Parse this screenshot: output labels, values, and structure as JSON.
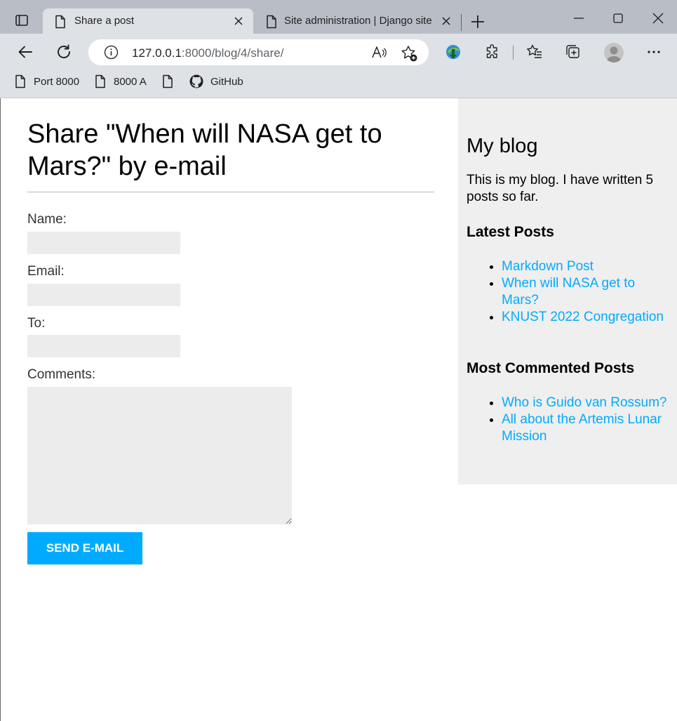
{
  "browser": {
    "tabs": [
      {
        "title": "Share a post",
        "active": true
      },
      {
        "title": "Site administration | Django site admin",
        "active": false
      }
    ],
    "url_host": "127.0.0.1",
    "url_rest": ":8000/blog/4/share/",
    "bookmarks": [
      {
        "label": "Port 8000",
        "icon": "page-icon"
      },
      {
        "label": "8000 A",
        "icon": "page-icon"
      },
      {
        "label": "",
        "icon": "page-icon"
      },
      {
        "label": "GitHub",
        "icon": "github-icon"
      }
    ]
  },
  "form": {
    "heading": "Share \"When will NASA get to Mars?\" by e-mail",
    "name_label": "Name:",
    "email_label": "Email:",
    "to_label": "To:",
    "comments_label": "Comments:",
    "name_value": "",
    "email_value": "",
    "to_value": "",
    "comments_value": "",
    "submit_label": "Send e-mail"
  },
  "sidebar": {
    "title": "My blog",
    "description": "This is my blog. I have written 5 posts so far.",
    "latest_heading": "Latest Posts",
    "latest_posts": [
      "Markdown Post",
      "When will NASA get to Mars?",
      "KNUST 2022 Congregation"
    ],
    "most_commented_heading": "Most Commented Posts",
    "most_commented_posts": [
      "Who is Guido van Rossum?",
      "All about the Artemis Lunar Mission"
    ]
  },
  "colors": {
    "accent": "#00abff",
    "input_bg": "#ececec",
    "sidebar_bg": "#efefef",
    "tabstrip_bg": "#b9bec6",
    "toolbar_bg": "#dee1e6"
  }
}
